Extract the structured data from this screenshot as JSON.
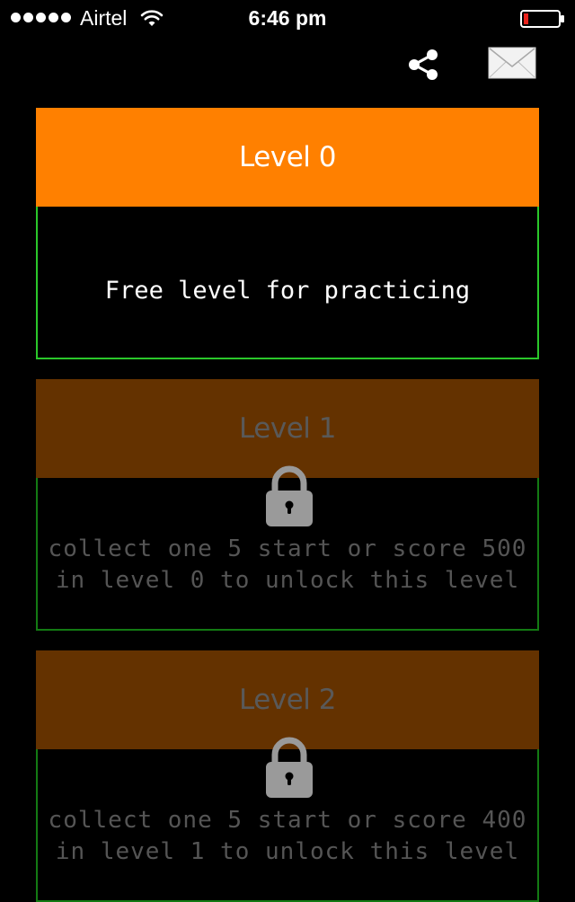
{
  "status_bar": {
    "carrier": "Airtel",
    "time": "6:46 pm",
    "signal_bars": 5,
    "battery_level": 0.1
  },
  "actions": {
    "share_icon": "share-icon",
    "mail_icon": "mail-icon"
  },
  "colors": {
    "unlocked_header": "#ff8000",
    "locked_header": "#643200",
    "unlocked_border": "#2ac72a",
    "locked_border": "#137a13"
  },
  "levels": [
    {
      "title": "Level 0",
      "locked": false,
      "description": "Free level for practicing"
    },
    {
      "title": "Level 1",
      "locked": true,
      "description_line1": "collect one 5 start or score 500",
      "description_line2": "in level 0 to unlock this level"
    },
    {
      "title": "Level 2",
      "locked": true,
      "description_line1": "collect one 5 start or score 400",
      "description_line2": "in level 1 to unlock this level"
    }
  ]
}
